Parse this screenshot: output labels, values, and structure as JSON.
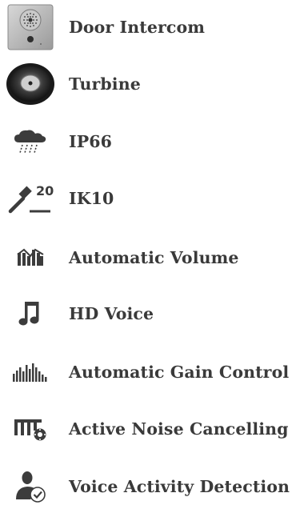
{
  "features": {
    "items": [
      {
        "label": "Door Intercom",
        "icon": "door-intercom-icon"
      },
      {
        "label": "Turbine",
        "icon": "turbine-speaker-icon"
      },
      {
        "label": "IP66",
        "icon": "rain-cloud-icon"
      },
      {
        "label": "IK10",
        "icon": "hammer-impact-icon",
        "icon_text": "20"
      },
      {
        "label": "Automatic Volume",
        "icon": "volume-bars-icon"
      },
      {
        "label": "HD Voice",
        "icon": "music-note-icon"
      },
      {
        "label": "Automatic Gain Control",
        "icon": "gain-bars-icon"
      },
      {
        "label": "Active Noise Cancelling",
        "icon": "noise-cancel-icon"
      },
      {
        "label": "Voice Activity Detection",
        "icon": "voice-activity-user-icon"
      }
    ]
  },
  "colors": {
    "text": "#3a3a3a",
    "icon": "#3c3c3c"
  }
}
